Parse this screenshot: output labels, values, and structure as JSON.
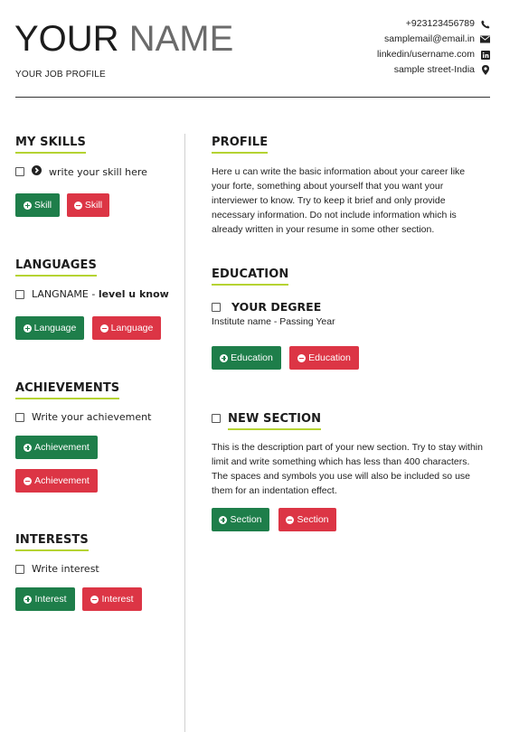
{
  "header": {
    "name_first": "YOUR",
    "name_last": "NAME",
    "job_profile": "YOUR JOB PROFILE",
    "contacts": [
      {
        "text": "+923123456789",
        "icon": "phone-icon"
      },
      {
        "text": "samplemail@email.in",
        "icon": "envelope-icon"
      },
      {
        "text": "linkedin/username.com",
        "icon": "linkedin-icon"
      },
      {
        "text": "sample street-India",
        "icon": "map-marker-icon"
      }
    ]
  },
  "left": {
    "skills": {
      "title": "MY SKILLS",
      "items": [
        "write your skill here"
      ],
      "add_label": "Skill",
      "remove_label": "Skill"
    },
    "languages": {
      "title": "LANGUAGES",
      "item_name": "LANGNAME",
      "item_sep": " - ",
      "item_level": "level u know",
      "add_label": "Language",
      "remove_label": "Language"
    },
    "achievements": {
      "title": "ACHIEVEMENTS",
      "items": [
        "Write your achievement"
      ],
      "add_label": "Achievement",
      "remove_label": "Achievement"
    },
    "interests": {
      "title": "INTERESTS",
      "items": [
        "Write interest"
      ],
      "add_label": "Interest",
      "remove_label": "Interest"
    }
  },
  "right": {
    "profile": {
      "title": "PROFILE",
      "text": "Here u can write the basic information about your career like your forte, something about yourself that you want your interviewer to know. Try to keep it brief and only provide necessary information. Do not include information which is already written in your resume in some other section."
    },
    "education": {
      "title": "EDUCATION",
      "degree": "YOUR DEGREE",
      "institute": "Institute name - Passing Year",
      "add_label": "Education",
      "remove_label": "Education"
    },
    "new_section": {
      "title": "NEW SECTION",
      "text": "This is the description part of your new section. Try to stay within limit and write something which has less than 400 characters. The spaces and symbols you use will also be included so use them for an indentation effect.",
      "add_label": "Section",
      "remove_label": "Section"
    }
  },
  "colors": {
    "accent_underline": "#b5d332",
    "add_button": "#1e7e4a",
    "remove_button": "#dc3545"
  }
}
